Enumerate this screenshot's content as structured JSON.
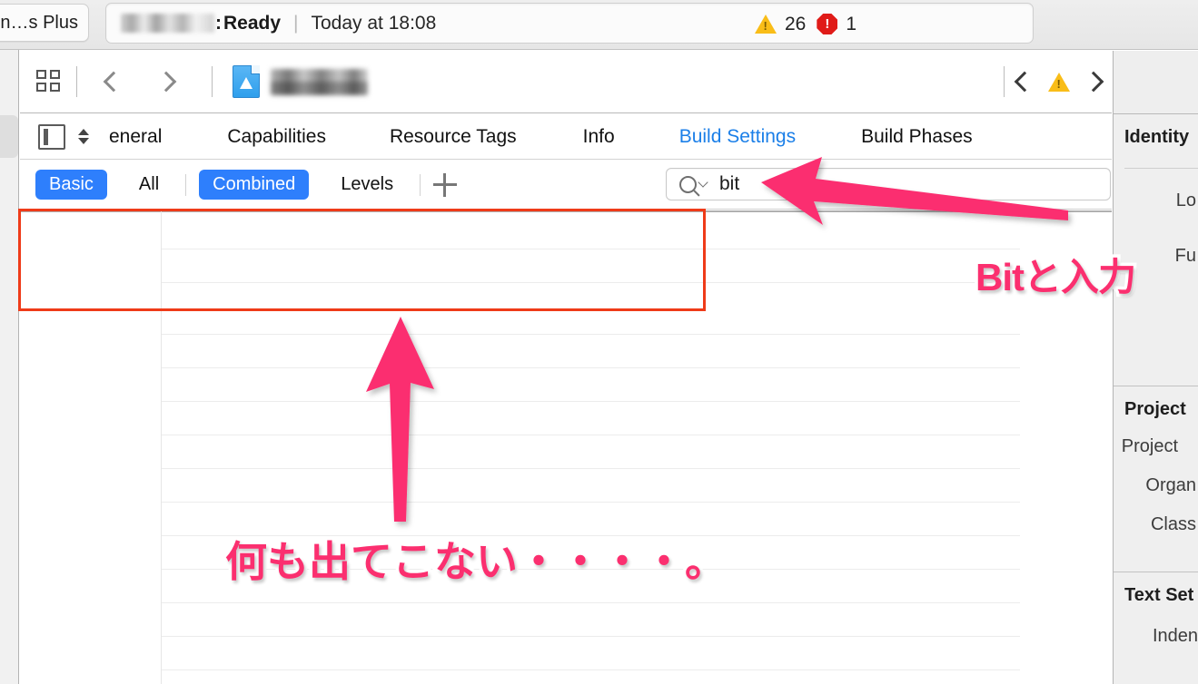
{
  "window": {
    "scheme_label": "n…s Plus",
    "status": {
      "project_blurred": true,
      "separator_colon": ":",
      "state": "Ready",
      "divider": "|",
      "time": "Today at 18:08"
    },
    "issues": {
      "warning_icon": "warning-triangle-icon",
      "warning_count": "26",
      "error_icon": "error-octagon-icon",
      "error_count": "1"
    }
  },
  "jumpbar": {
    "grid_icon": "grid-view-icon",
    "back_icon": "chevron-left-icon",
    "forward_icon": "chevron-right-icon",
    "project_icon": "xcode-project-icon",
    "project_name_blurred": true,
    "issue_prev_icon": "chevron-left-icon",
    "issue_warning_icon": "warning-triangle-icon",
    "issue_next_icon": "chevron-right-icon"
  },
  "editor": {
    "target_icon": "target-list-icon",
    "stepper_icon": "stepper-updown-icon",
    "tabs": [
      {
        "label": "eneral",
        "active": false
      },
      {
        "label": "Capabilities",
        "active": false
      },
      {
        "label": "Resource Tags",
        "active": false
      },
      {
        "label": "Info",
        "active": false
      },
      {
        "label": "Build Settings",
        "active": true
      },
      {
        "label": "Build Phases",
        "active": false
      }
    ],
    "filters": [
      {
        "label": "Basic",
        "selected": true
      },
      {
        "label": "All",
        "selected": false
      },
      {
        "label": "Combined",
        "selected": true
      },
      {
        "label": "Levels",
        "selected": false
      }
    ],
    "add_button_icon": "plus-icon",
    "search": {
      "icon": "search-magnifier-icon",
      "dropdown_icon": "chevron-down-icon",
      "value": "bit",
      "placeholder": ""
    },
    "table": {
      "rows": [],
      "empty": true
    }
  },
  "inspector": {
    "sections": [
      {
        "title": "Identity",
        "labels": [
          "Lo",
          "Fu"
        ]
      },
      {
        "title": "Project ",
        "labels": [
          "Project ",
          "Organ",
          "Class"
        ]
      },
      {
        "title": "Text Set",
        "labels": [
          "Inden"
        ]
      }
    ]
  },
  "annotations": [
    {
      "name": "bit-input-note",
      "text": "Bitと入力"
    },
    {
      "name": "nothing-appears-note",
      "text": "何も出てこない・・・・。"
    }
  ],
  "highlights": {
    "red_box_color": "#ef3b19",
    "arrow_color": "#fb2f6f",
    "accent_blue": "#2e7ffc",
    "link_blue": "#1b7fe8"
  }
}
